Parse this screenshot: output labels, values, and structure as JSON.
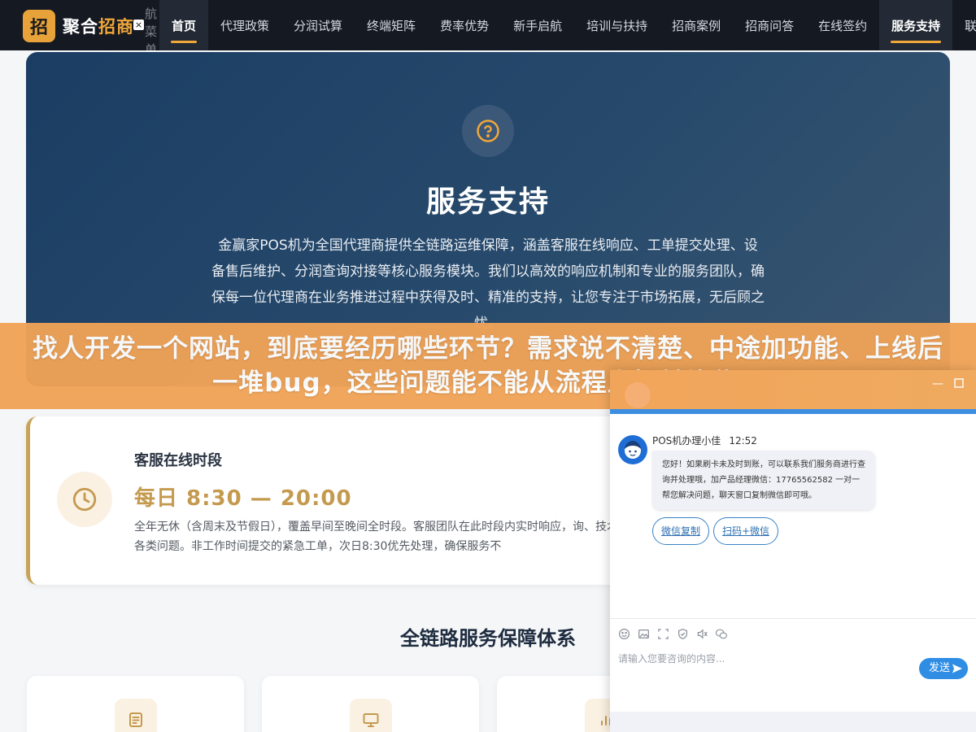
{
  "header": {
    "logo_badge": "招",
    "logo_main": "聚合",
    "logo_accent": "招商",
    "close_symbol": "×",
    "side_label": "航菜单",
    "nav": [
      "首页",
      "代理政策",
      "分润试算",
      "终端矩阵",
      "费率优势",
      "新手启航",
      "培训与扶持",
      "招商案例",
      "招商问答",
      "在线签约",
      "服务支持",
      "联系"
    ]
  },
  "hero": {
    "title": "服务支持",
    "description": "金赢家POS机为全国代理商提供全链路运维保障，涵盖客服在线响应、工单提交处理、设备售后维护、分润查询对接等核心服务模块。我们以高效的响应机制和专业的服务团队，确保每一位代理商在业务推进过程中获得及时、精准的支持，让您专注于市场拓展，无后顾之忧。"
  },
  "banner": {
    "text": "找人开发一个网站，到底要经历哪些环节？需求说不清楚、中途加功能、上线后一堆bug，这些问题能不能从流程上提前堵住？"
  },
  "hours": {
    "label": "客服在线时段",
    "value": "每日 8:30 — 20:00",
    "desc": "全年无休（含周末及节假日），覆盖早间至晚间全时段。客服团队在此时段内实时响应，询、技术故障等各类问题。非工作时间提交的紧急工单，次日8:30优先处理，确保服务不"
  },
  "section": {
    "title": "全链路服务保障体系"
  },
  "chat": {
    "agent_name": "POS机办理小佳",
    "time": "12:52",
    "message": "您好！如果刷卡未及时到账，可以联系我们服务商进行查询并处理哦，加产品经理微信：17765562582 一对一帮您解决问题，聊天窗口复制微信即可哦。",
    "quick_buttons": [
      "微信复制",
      "扫码+微信"
    ],
    "input_placeholder": "请输入您要咨询的内容...",
    "send_label": "发送"
  },
  "colors": {
    "nav_bg": "#141922",
    "accent_gold": "#f0a73a",
    "hero_blue": "#1b3d63",
    "banner_orange": "#f0a357",
    "chat_blue": "#2f8de4"
  }
}
